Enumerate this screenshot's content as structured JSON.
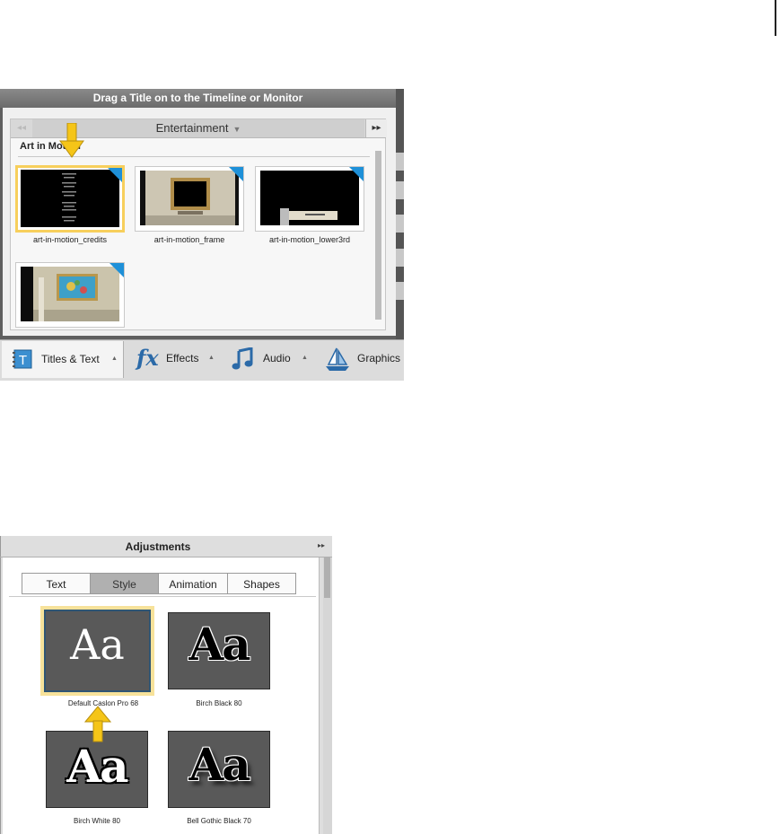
{
  "titles_panel": {
    "header": "Drag a Title on to the Timeline or Monitor",
    "category": "Entertainment",
    "section_title": "Art in Motion",
    "thumbnails": [
      {
        "label": "art-in-motion_credits",
        "selected": true
      },
      {
        "label": "art-in-motion_frame",
        "selected": false
      },
      {
        "label": "art-in-motion_lower3rd",
        "selected": false
      },
      {
        "label": "",
        "selected": false
      }
    ],
    "tabs": {
      "titles": "Titles & Text",
      "effects": "Effects",
      "audio": "Audio",
      "graphics": "Graphics"
    },
    "icons": {
      "titles": "text-t-icon",
      "effects": "fx-icon",
      "audio": "music-note-icon",
      "graphics": "sailboat-icon"
    }
  },
  "adjustments_panel": {
    "title": "Adjustments",
    "segments": [
      "Text",
      "Style",
      "Animation",
      "Shapes"
    ],
    "active_segment": "Style",
    "styles": [
      {
        "label": "Default Caslon Pro 68",
        "sample": "Aa",
        "selected": true
      },
      {
        "label": "Birch Black 80",
        "sample": "Aa",
        "selected": false
      },
      {
        "label": "Birch White 80",
        "sample": "Aa",
        "selected": false
      },
      {
        "label": "Bell Gothic Black 70",
        "sample": "Aa",
        "selected": false
      }
    ]
  },
  "colors": {
    "highlight": "#f7cf5c",
    "callout_arrow": "#f5c518",
    "corner_badge": "#1e90d8",
    "tile_bg": "#595959"
  }
}
